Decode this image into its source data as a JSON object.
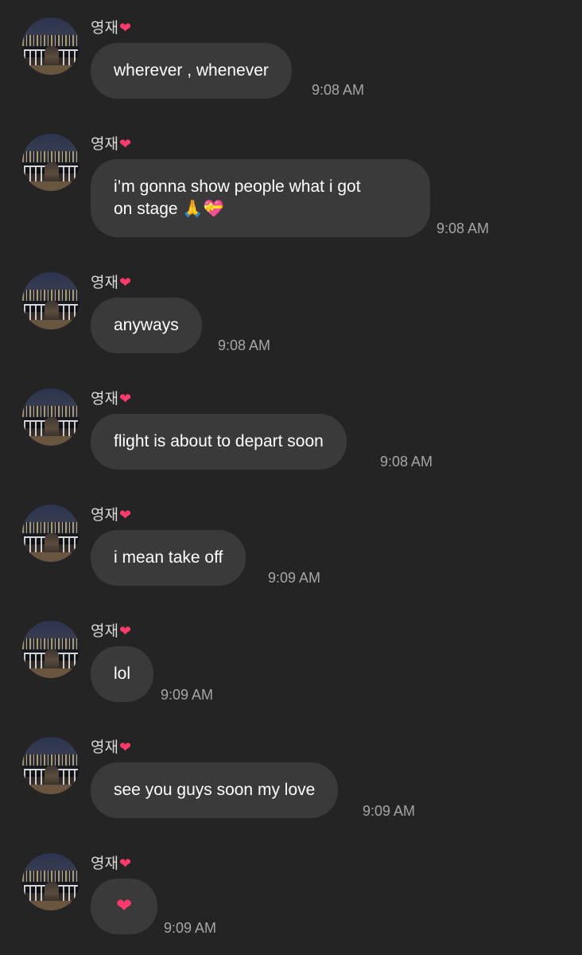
{
  "sender_name": "영재",
  "sender_heart": "❤",
  "messages": [
    {
      "text": "wherever , whenever",
      "time": "9:08 AM"
    },
    {
      "line1": "i’m gonna show people what i got",
      "line2": "on stage 🙏💝",
      "time": "9:08 AM"
    },
    {
      "text": "anyways",
      "time": "9:08 AM"
    },
    {
      "text": "flight is about to depart soon",
      "time": "9:08 AM"
    },
    {
      "text": "i mean take off",
      "time": "9:09 AM"
    },
    {
      "text": "lol",
      "time": "9:09 AM"
    },
    {
      "text": "see you guys soon my love",
      "time": "9:09 AM"
    },
    {
      "text": "❤",
      "time": "9:09 AM"
    }
  ],
  "colors": {
    "background": "#242424",
    "bubble": "#3a3a3a",
    "text": "#ffffff",
    "timestamp": "#a6a6a6",
    "heart": "#ff3b6b"
  }
}
